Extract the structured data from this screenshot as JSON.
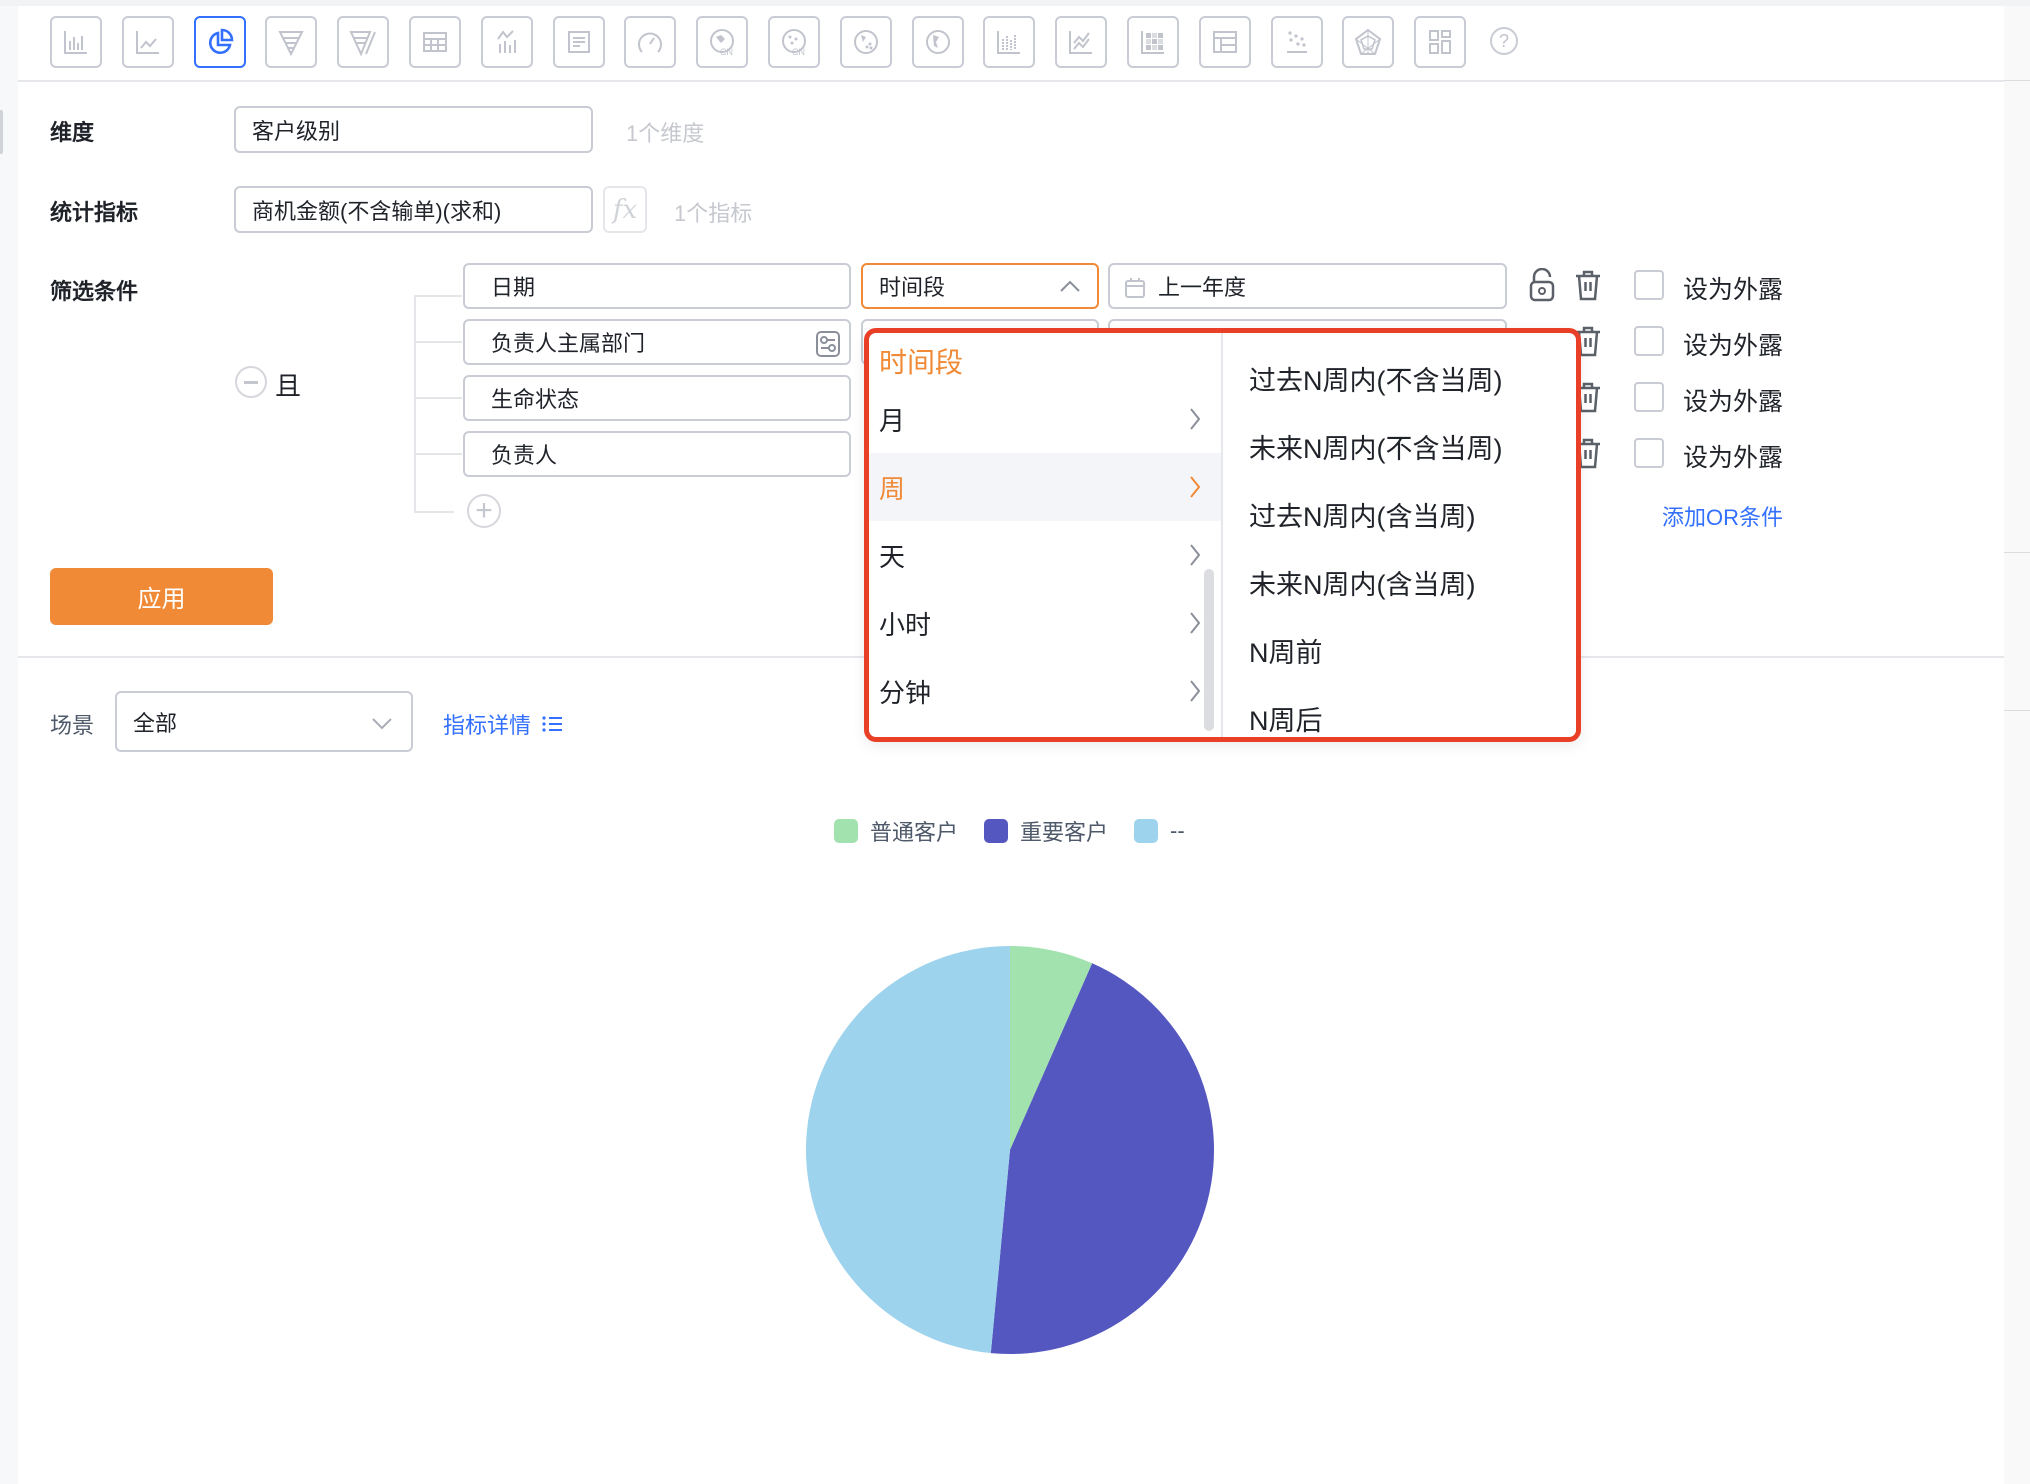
{
  "toolbar": {
    "icons": [
      {
        "name": "bar-chart-icon",
        "active": false
      },
      {
        "name": "line-chart-icon",
        "active": false
      },
      {
        "name": "pie-chart-icon",
        "active": true
      },
      {
        "name": "funnel-chart-icon",
        "active": false
      },
      {
        "name": "funnel-compare-icon",
        "active": false
      },
      {
        "name": "table-icon",
        "active": false
      },
      {
        "name": "bar-line-combo-icon",
        "active": false
      },
      {
        "name": "text-card-icon",
        "active": false
      },
      {
        "name": "gauge-icon",
        "active": false
      },
      {
        "name": "china-map-icon",
        "active": false
      },
      {
        "name": "china-scatter-map-icon",
        "active": false
      },
      {
        "name": "world-scatter-map-icon",
        "active": false
      },
      {
        "name": "world-map-icon",
        "active": false
      },
      {
        "name": "stacked-bar-icon",
        "active": false
      },
      {
        "name": "multi-line-icon",
        "active": false
      },
      {
        "name": "heatmap-icon",
        "active": false
      },
      {
        "name": "pivot-table-icon",
        "active": false
      },
      {
        "name": "scatter-icon",
        "active": false
      },
      {
        "name": "radar-icon",
        "active": false
      },
      {
        "name": "dashboard-grid-icon",
        "active": false
      }
    ],
    "help": "?"
  },
  "form": {
    "dimension": {
      "label": "维度",
      "value": "客户级别",
      "hint": "1个维度"
    },
    "metric": {
      "label": "统计指标",
      "value": "商机金额(不含输单)(求和)",
      "fx": "fx",
      "hint": "1个指标"
    },
    "filter": {
      "label": "筛选条件",
      "logic": "且",
      "rows": [
        {
          "field": "日期",
          "operator": "时间段",
          "value": "上一年度",
          "expose_label": "设为外露",
          "expose_checked": false
        },
        {
          "field": "负责人主属部门",
          "expose_label": "设为外露",
          "expose_checked": false
        },
        {
          "field": "生命状态",
          "expose_label": "设为外露",
          "expose_checked": false
        },
        {
          "field": "负责人",
          "expose_label": "设为外露",
          "expose_checked": false
        }
      ],
      "add_or": "添加OR条件"
    },
    "apply": "应用"
  },
  "dropdown": {
    "title": "时间段",
    "categories": [
      {
        "label": "月",
        "selected": false
      },
      {
        "label": "周",
        "selected": true
      },
      {
        "label": "天",
        "selected": false
      },
      {
        "label": "小时",
        "selected": false
      },
      {
        "label": "分钟",
        "selected": false
      }
    ],
    "options": [
      "过去N周内(不含当周)",
      "未来N周内(不含当周)",
      "过去N周内(含当周)",
      "未来N周内(含当周)",
      "N周前",
      "N周后"
    ]
  },
  "scene": {
    "label": "场景",
    "value": "全部",
    "detail_link": "指标详情",
    "detail_icon": "list-icon"
  },
  "colors": {
    "accent": "#f08a36",
    "link": "#3370ff",
    "highlight_box": "#ea3f27"
  },
  "chart_data": {
    "type": "pie",
    "title": "",
    "legend_position": "top-center",
    "categories": [
      "普通客户",
      "重要客户",
      "--"
    ],
    "values": [
      6.6,
      44.9,
      48.5
    ],
    "unit": "percent (estimated share)",
    "colors": [
      "#a2e2ae",
      "#5357bf",
      "#9ed3ee"
    ],
    "start_angle": "12 o'clock, clockwise"
  }
}
